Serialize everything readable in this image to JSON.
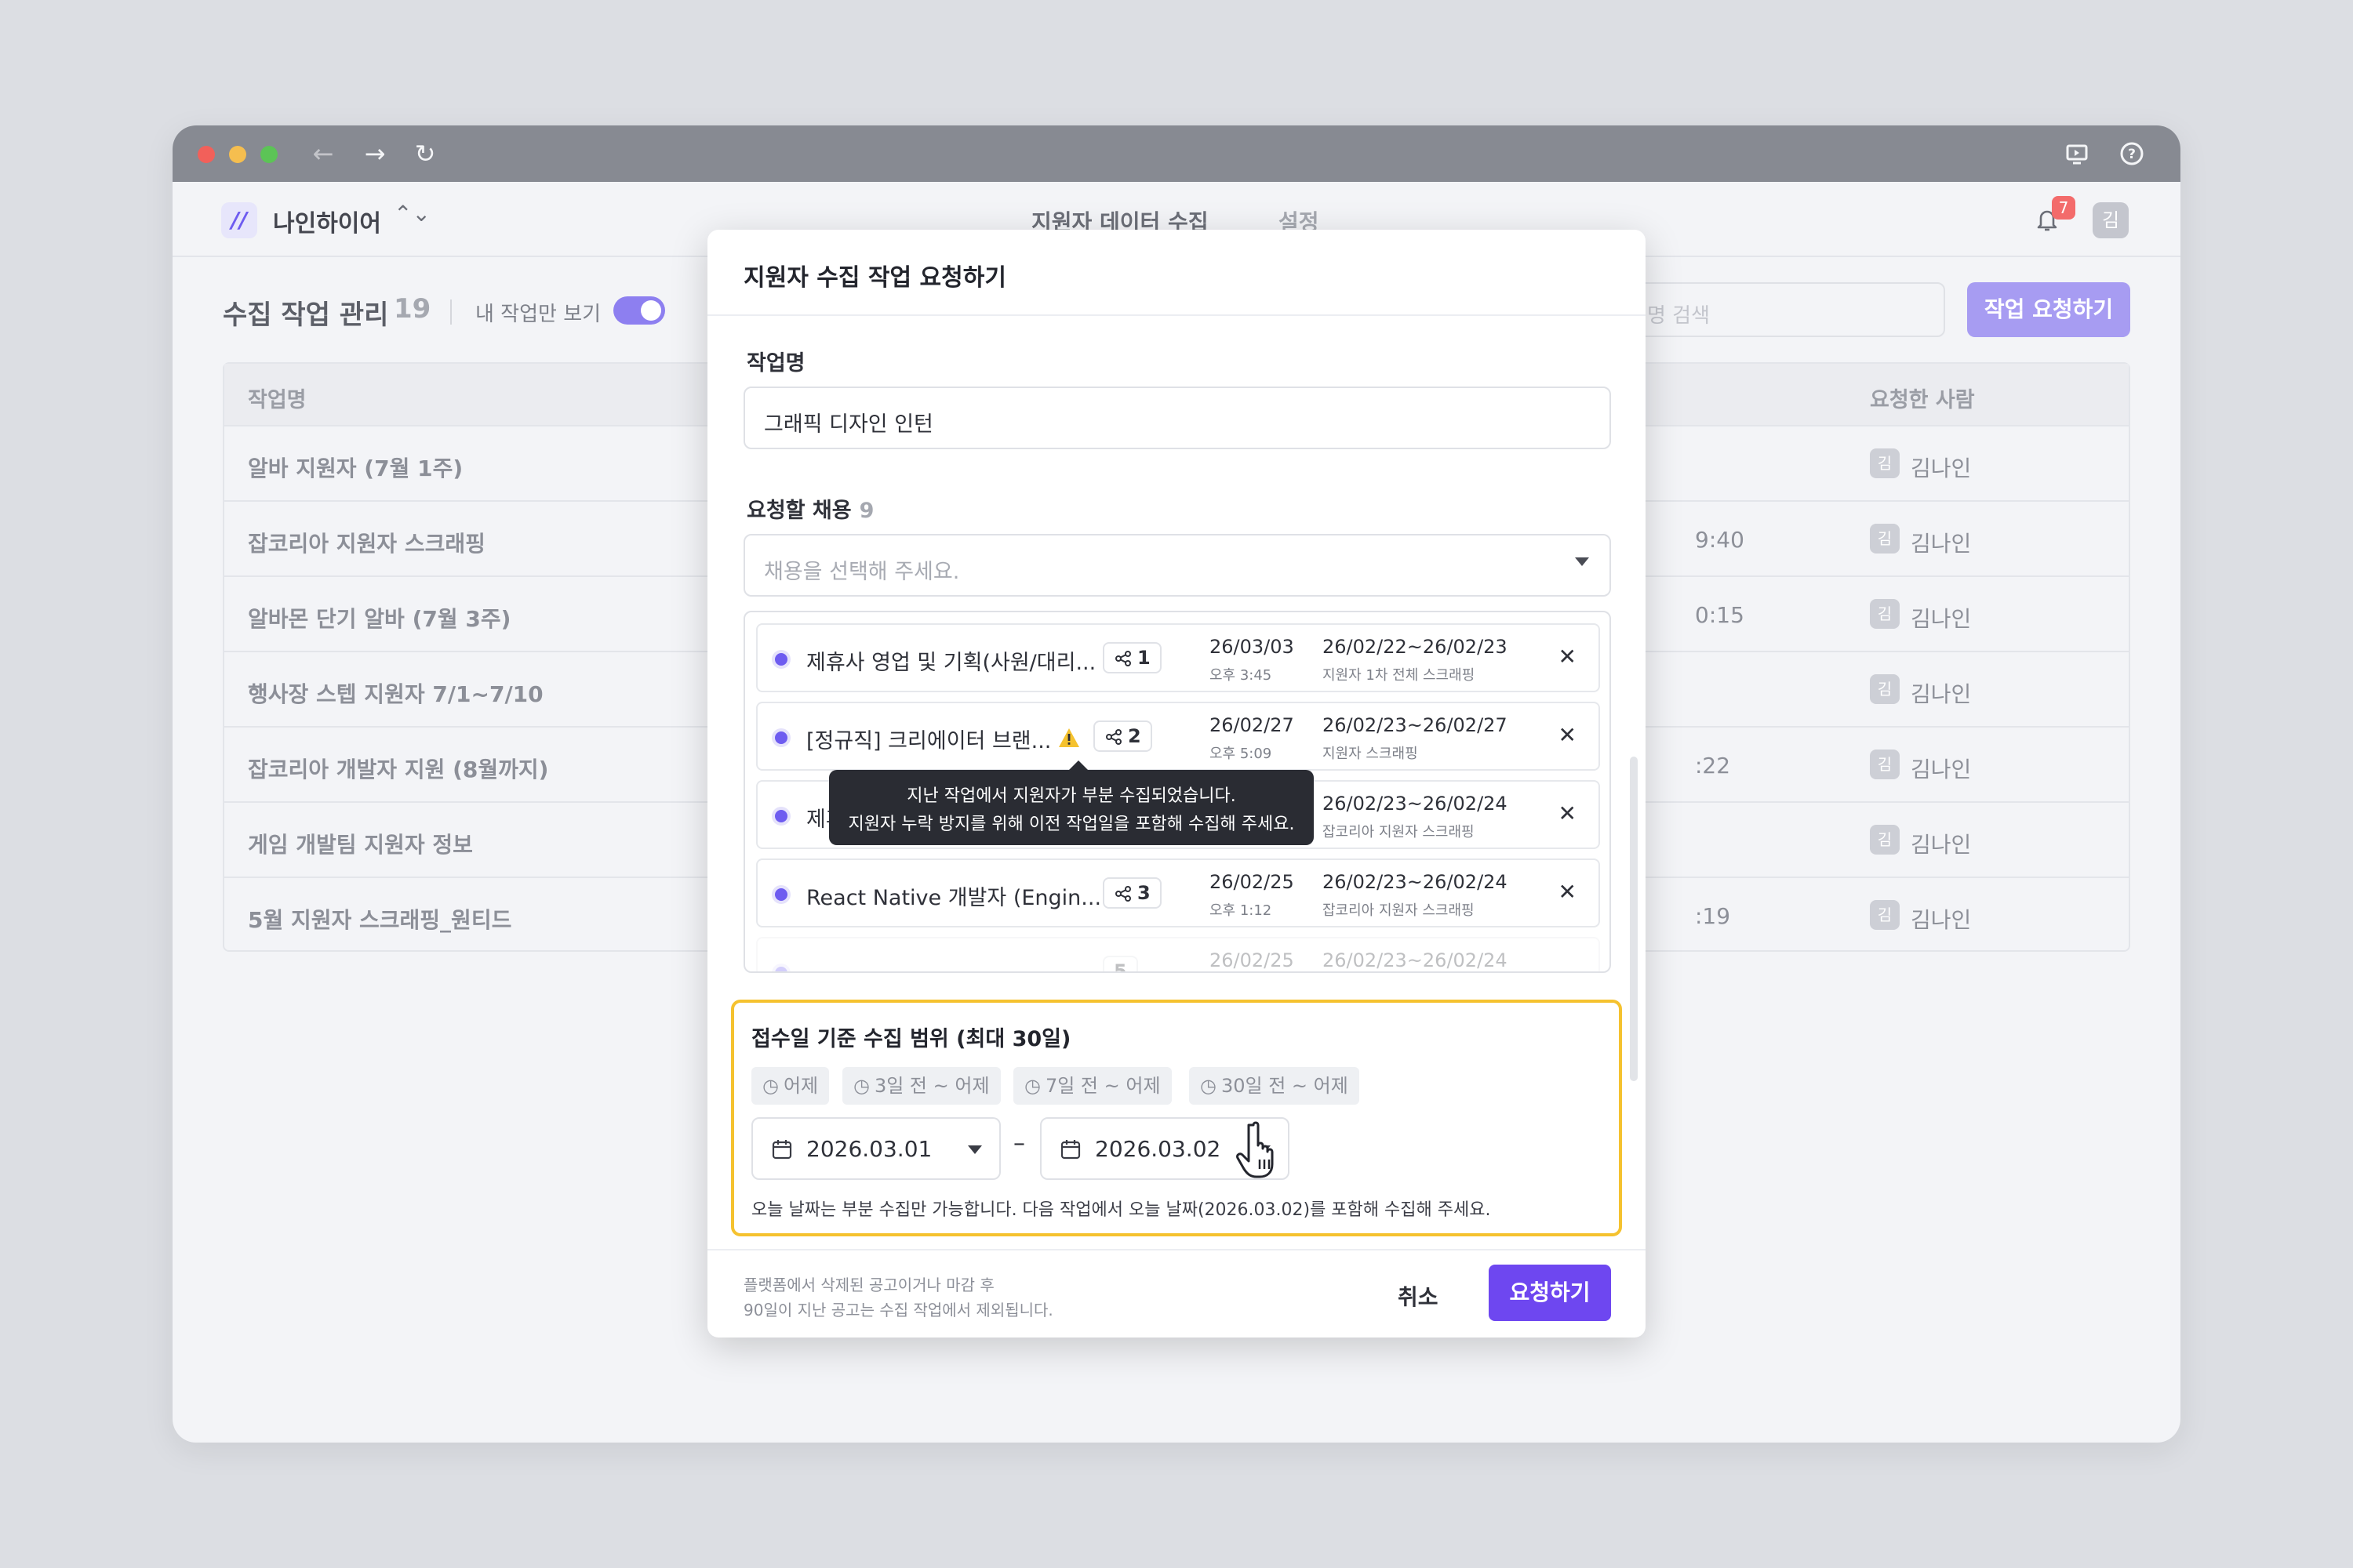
{
  "app": {
    "org_name": "나인하이어",
    "nav_tabs": [
      "지원자 데이터 수집",
      "설정"
    ],
    "notification_count": "7",
    "user_initial": "김"
  },
  "page": {
    "title": "수집 작업 관리",
    "count": "19",
    "mine_only_label": "내 작업만 보기",
    "mine_only_on": true,
    "search_placeholder": "명 검색",
    "request_button": "작업 요청하기",
    "columns": [
      "작업명",
      "요청한 사람"
    ],
    "rows": [
      {
        "name": "알바 지원자 (7월 1주)",
        "time": "",
        "avatar": "김",
        "user": "김나인"
      },
      {
        "name": "잡코리아 지원자 스크래핑",
        "time": "9:40",
        "avatar": "김",
        "user": "김나인"
      },
      {
        "name": "알바몬 단기 알바 (7월 3주)",
        "time": "0:15",
        "avatar": "김",
        "user": "김나인"
      },
      {
        "name": "행사장 스텝 지원자 7/1~7/10",
        "time": "",
        "avatar": "김",
        "user": "김나인"
      },
      {
        "name": "잡코리아 개발자 지원 (8월까지)",
        "time": ":22",
        "avatar": "김",
        "user": "김나인"
      },
      {
        "name": "게임 개발팀 지원자 정보",
        "time": "",
        "avatar": "김",
        "user": "김나인"
      },
      {
        "name": "5월 지원자 스크래핑_원티드",
        "time": ":19",
        "avatar": "김",
        "user": "김나인"
      }
    ]
  },
  "modal": {
    "title": "지원자 수집 작업 요청하기",
    "job_name_label": "작업명",
    "job_name_value": "그래픽 디자인 인턴",
    "hire_label": "요청할 채용",
    "hire_count": "9",
    "hire_placeholder": "채용을 선택해 주세요.",
    "items": [
      {
        "name": "제휴사 영업 및 기획(사원/대리...",
        "share": "1",
        "date": "26/03/03",
        "time": "오후 3:45",
        "range": "26/02/22~26/02/23",
        "source": "지원자 1차 전체 스크래핑",
        "warn": false
      },
      {
        "name": "[정규직] 크리에이터 브랜...",
        "share": "2",
        "date": "26/02/27",
        "time": "오후 5:09",
        "range": "26/02/23~26/02/27",
        "source": "지원자 스크래핑",
        "warn": true
      },
      {
        "name": "제휴",
        "share": "",
        "date": "",
        "time": "",
        "range": "26/02/23~26/02/24",
        "source": "잡코리아 지원자 스크래핑",
        "warn": false
      },
      {
        "name": "React Native 개발자 (Engin...",
        "share": "3",
        "date": "26/02/25",
        "time": "오후 1:12",
        "range": "26/02/23~26/02/24",
        "source": "잡코리아 지원자 스크래핑",
        "warn": false
      },
      {
        "name": "",
        "share": "5",
        "date": "26/02/25",
        "time": "",
        "range": "26/02/23~26/02/24",
        "source": "",
        "warn": false
      }
    ],
    "tooltip_line1": "지난 작업에서 지원자가 부분 수집되었습니다.",
    "tooltip_line2": "지원자 누락 방지를 위해 이전 작업일을 포함해 수집해 주세요.",
    "range_title": "접수일 기준 수집 범위 (최대 30일)",
    "presets": [
      "어제",
      "3일 전 ~ 어제",
      "7일 전 ~ 어제",
      "30일 전 ~ 어제"
    ],
    "start_date": "2026.03.01",
    "end_date": "2026.03.02",
    "range_separator": "–",
    "range_note": "오늘 날짜는 부분 수집만 가능합니다. 다음 작업에서 오늘 날짜(2026.03.02)를 포함해 수집해 주세요.",
    "footer_note_1": "플랫폼에서 삭제된 공고이거나 마감 후",
    "footer_note_2": "90일이 지난 공고는 수집 작업에서 제외됩니다.",
    "cancel": "취소",
    "submit": "요청하기"
  },
  "colors": {
    "accent": "#6e47f0",
    "warning": "#f5c22f",
    "badge": "#f36b6b"
  }
}
